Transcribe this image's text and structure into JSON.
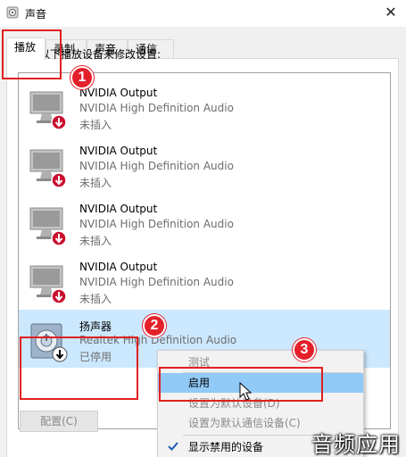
{
  "window": {
    "title": "声音",
    "close_glyph": "✕"
  },
  "tabs": [
    {
      "label": "播放",
      "active": true
    },
    {
      "label": "录制",
      "active": false
    },
    {
      "label": "声音",
      "active": false
    },
    {
      "label": "通信",
      "active": false
    }
  ],
  "instruction": "选择以下播放设备来修改设置:",
  "devices": [
    {
      "name": "NVIDIA Output",
      "desc": "NVIDIA High Definition Audio",
      "status": "未插入",
      "icon": "monitor-icon",
      "overlay": "red-down-arrow-icon"
    },
    {
      "name": "NVIDIA Output",
      "desc": "NVIDIA High Definition Audio",
      "status": "未插入",
      "icon": "monitor-icon",
      "overlay": "red-down-arrow-icon"
    },
    {
      "name": "NVIDIA Output",
      "desc": "NVIDIA High Definition Audio",
      "status": "未插入",
      "icon": "monitor-icon",
      "overlay": "red-down-arrow-icon"
    },
    {
      "name": "NVIDIA Output",
      "desc": "NVIDIA High Definition Audio",
      "status": "未插入",
      "icon": "monitor-icon",
      "overlay": "red-down-arrow-icon"
    },
    {
      "name": "扬声器",
      "desc": "Realtek High Definition Audio",
      "status": "已停用",
      "icon": "speaker-icon",
      "overlay": "black-down-arrow-icon",
      "selected": true
    }
  ],
  "buttons": {
    "configure": "配置(C)"
  },
  "context_menu": {
    "items": [
      {
        "label": "测试",
        "disabled": true
      },
      {
        "label": "启用",
        "disabled": false,
        "hover": true
      },
      {
        "label": "设置为默认设备(D)",
        "disabled": true
      },
      {
        "label": "设置为默认通信设备(C)",
        "disabled": true
      },
      {
        "label": "显示禁用的设备",
        "checked": true
      }
    ]
  },
  "annotations": {
    "step1": "1",
    "step2": "2",
    "step3": "3"
  },
  "watermark": "音频应用",
  "colors": {
    "accent_red": "#e4202a",
    "selection": "#cce8ff",
    "menu_hover": "#91c9f7",
    "disabled_text": "#8a8a8a"
  }
}
